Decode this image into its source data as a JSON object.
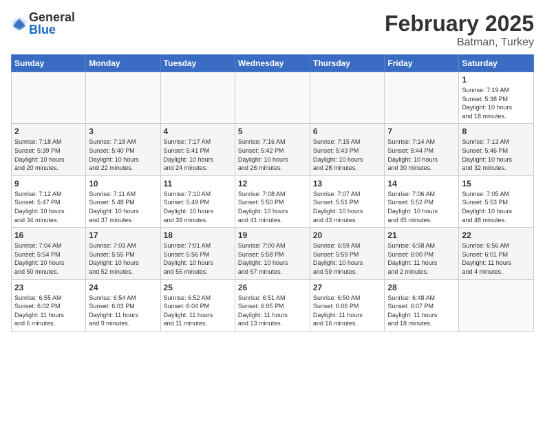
{
  "header": {
    "logo_general": "General",
    "logo_blue": "Blue",
    "month_year": "February 2025",
    "location": "Batman, Turkey"
  },
  "weekdays": [
    "Sunday",
    "Monday",
    "Tuesday",
    "Wednesday",
    "Thursday",
    "Friday",
    "Saturday"
  ],
  "weeks": [
    [
      {
        "day": "",
        "info": ""
      },
      {
        "day": "",
        "info": ""
      },
      {
        "day": "",
        "info": ""
      },
      {
        "day": "",
        "info": ""
      },
      {
        "day": "",
        "info": ""
      },
      {
        "day": "",
        "info": ""
      },
      {
        "day": "1",
        "info": "Sunrise: 7:19 AM\nSunset: 5:38 PM\nDaylight: 10 hours\nand 18 minutes."
      }
    ],
    [
      {
        "day": "2",
        "info": "Sunrise: 7:18 AM\nSunset: 5:39 PM\nDaylight: 10 hours\nand 20 minutes."
      },
      {
        "day": "3",
        "info": "Sunrise: 7:18 AM\nSunset: 5:40 PM\nDaylight: 10 hours\nand 22 minutes."
      },
      {
        "day": "4",
        "info": "Sunrise: 7:17 AM\nSunset: 5:41 PM\nDaylight: 10 hours\nand 24 minutes."
      },
      {
        "day": "5",
        "info": "Sunrise: 7:16 AM\nSunset: 5:42 PM\nDaylight: 10 hours\nand 26 minutes."
      },
      {
        "day": "6",
        "info": "Sunrise: 7:15 AM\nSunset: 5:43 PM\nDaylight: 10 hours\nand 28 minutes."
      },
      {
        "day": "7",
        "info": "Sunrise: 7:14 AM\nSunset: 5:44 PM\nDaylight: 10 hours\nand 30 minutes."
      },
      {
        "day": "8",
        "info": "Sunrise: 7:13 AM\nSunset: 5:46 PM\nDaylight: 10 hours\nand 32 minutes."
      }
    ],
    [
      {
        "day": "9",
        "info": "Sunrise: 7:12 AM\nSunset: 5:47 PM\nDaylight: 10 hours\nand 34 minutes."
      },
      {
        "day": "10",
        "info": "Sunrise: 7:11 AM\nSunset: 5:48 PM\nDaylight: 10 hours\nand 37 minutes."
      },
      {
        "day": "11",
        "info": "Sunrise: 7:10 AM\nSunset: 5:49 PM\nDaylight: 10 hours\nand 39 minutes."
      },
      {
        "day": "12",
        "info": "Sunrise: 7:08 AM\nSunset: 5:50 PM\nDaylight: 10 hours\nand 41 minutes."
      },
      {
        "day": "13",
        "info": "Sunrise: 7:07 AM\nSunset: 5:51 PM\nDaylight: 10 hours\nand 43 minutes."
      },
      {
        "day": "14",
        "info": "Sunrise: 7:06 AM\nSunset: 5:52 PM\nDaylight: 10 hours\nand 45 minutes."
      },
      {
        "day": "15",
        "info": "Sunrise: 7:05 AM\nSunset: 5:53 PM\nDaylight: 10 hours\nand 48 minutes."
      }
    ],
    [
      {
        "day": "16",
        "info": "Sunrise: 7:04 AM\nSunset: 5:54 PM\nDaylight: 10 hours\nand 50 minutes."
      },
      {
        "day": "17",
        "info": "Sunrise: 7:03 AM\nSunset: 5:55 PM\nDaylight: 10 hours\nand 52 minutes."
      },
      {
        "day": "18",
        "info": "Sunrise: 7:01 AM\nSunset: 5:56 PM\nDaylight: 10 hours\nand 55 minutes."
      },
      {
        "day": "19",
        "info": "Sunrise: 7:00 AM\nSunset: 5:58 PM\nDaylight: 10 hours\nand 57 minutes."
      },
      {
        "day": "20",
        "info": "Sunrise: 6:59 AM\nSunset: 5:59 PM\nDaylight: 10 hours\nand 59 minutes."
      },
      {
        "day": "21",
        "info": "Sunrise: 6:58 AM\nSunset: 6:00 PM\nDaylight: 11 hours\nand 2 minutes."
      },
      {
        "day": "22",
        "info": "Sunrise: 6:56 AM\nSunset: 6:01 PM\nDaylight: 11 hours\nand 4 minutes."
      }
    ],
    [
      {
        "day": "23",
        "info": "Sunrise: 6:55 AM\nSunset: 6:02 PM\nDaylight: 11 hours\nand 6 minutes."
      },
      {
        "day": "24",
        "info": "Sunrise: 6:54 AM\nSunset: 6:03 PM\nDaylight: 11 hours\nand 9 minutes."
      },
      {
        "day": "25",
        "info": "Sunrise: 6:52 AM\nSunset: 6:04 PM\nDaylight: 11 hours\nand 11 minutes."
      },
      {
        "day": "26",
        "info": "Sunrise: 6:51 AM\nSunset: 6:05 PM\nDaylight: 11 hours\nand 13 minutes."
      },
      {
        "day": "27",
        "info": "Sunrise: 6:50 AM\nSunset: 6:06 PM\nDaylight: 11 hours\nand 16 minutes."
      },
      {
        "day": "28",
        "info": "Sunrise: 6:48 AM\nSunset: 6:07 PM\nDaylight: 11 hours\nand 18 minutes."
      },
      {
        "day": "",
        "info": ""
      }
    ]
  ]
}
